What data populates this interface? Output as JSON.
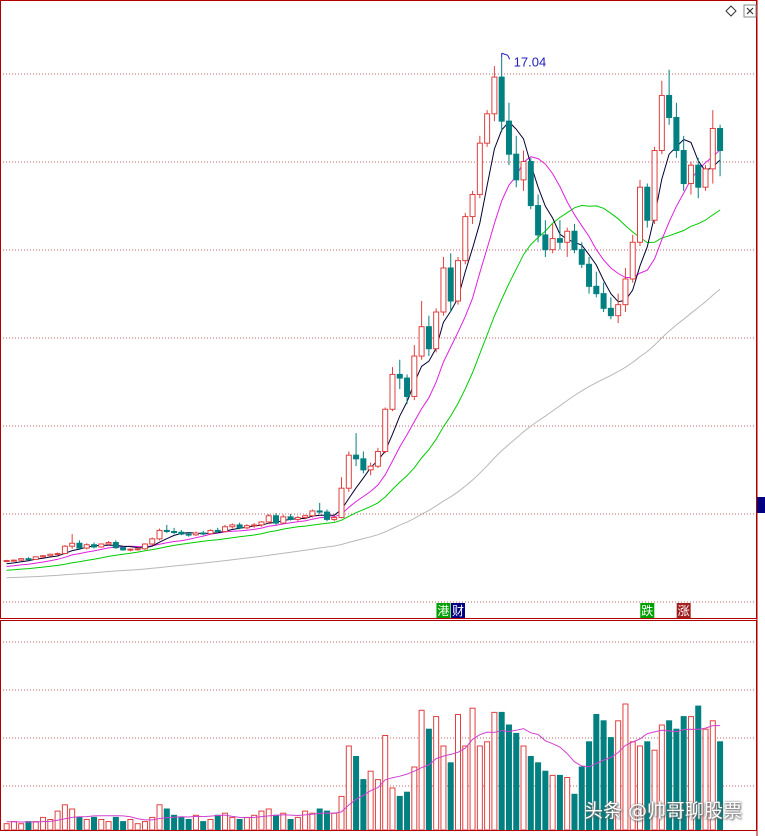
{
  "colors": {
    "border": "#b00000",
    "up": "#e04040",
    "down": "#008080",
    "ma5": "#000033",
    "ma10": "#e020e0",
    "ma20": "#00cc00",
    "ma60": "#b8b8b8",
    "vol_ma": "#d040d0",
    "peak_label": "#2020c0",
    "grid": "#c06060"
  },
  "chart_data": {
    "type": "candlestick",
    "peak": {
      "index": 68,
      "value": 17.04,
      "label": "17.04"
    },
    "price_ylim": [
      2.2,
      18.6
    ],
    "volume_ylim": [
      0,
      100
    ],
    "markers": [
      {
        "index": 60,
        "text": "港",
        "color": "#00a000"
      },
      {
        "index": 62,
        "text": "财",
        "color": "#000080"
      },
      {
        "index": 88,
        "text": "跌",
        "color": "#00a000"
      },
      {
        "index": 93,
        "text": "涨",
        "color": "#a02020"
      }
    ],
    "ohlc": [
      [
        3.31,
        3.35,
        3.28,
        3.33
      ],
      [
        3.33,
        3.36,
        3.3,
        3.34
      ],
      [
        3.34,
        3.4,
        3.32,
        3.38
      ],
      [
        3.38,
        3.42,
        3.34,
        3.36
      ],
      [
        3.36,
        3.45,
        3.35,
        3.43
      ],
      [
        3.43,
        3.48,
        3.4,
        3.46
      ],
      [
        3.46,
        3.52,
        3.44,
        3.5
      ],
      [
        3.5,
        3.55,
        3.47,
        3.52
      ],
      [
        3.52,
        3.75,
        3.5,
        3.72
      ],
      [
        3.72,
        4.05,
        3.65,
        3.8
      ],
      [
        3.8,
        3.88,
        3.62,
        3.67
      ],
      [
        3.67,
        3.8,
        3.63,
        3.76
      ],
      [
        3.76,
        3.82,
        3.66,
        3.7
      ],
      [
        3.7,
        3.8,
        3.68,
        3.78
      ],
      [
        3.78,
        3.86,
        3.74,
        3.82
      ],
      [
        3.82,
        3.88,
        3.65,
        3.68
      ],
      [
        3.68,
        3.72,
        3.6,
        3.62
      ],
      [
        3.62,
        3.66,
        3.58,
        3.64
      ],
      [
        3.64,
        3.68,
        3.6,
        3.65
      ],
      [
        3.65,
        3.8,
        3.62,
        3.78
      ],
      [
        3.78,
        3.96,
        3.74,
        3.92
      ],
      [
        3.92,
        4.2,
        3.88,
        4.15
      ],
      [
        4.15,
        4.3,
        4.08,
        4.12
      ],
      [
        4.12,
        4.22,
        4.05,
        4.1
      ],
      [
        4.1,
        4.16,
        4.02,
        4.05
      ],
      [
        4.05,
        4.1,
        3.98,
        4.03
      ],
      [
        4.03,
        4.12,
        4.0,
        4.08
      ],
      [
        4.08,
        4.14,
        4.02,
        4.06
      ],
      [
        4.06,
        4.18,
        4.04,
        4.15
      ],
      [
        4.15,
        4.22,
        4.08,
        4.12
      ],
      [
        4.12,
        4.3,
        4.1,
        4.25
      ],
      [
        4.25,
        4.34,
        4.2,
        4.3
      ],
      [
        4.3,
        4.36,
        4.18,
        4.22
      ],
      [
        4.22,
        4.32,
        4.18,
        4.28
      ],
      [
        4.28,
        4.35,
        4.22,
        4.3
      ],
      [
        4.3,
        4.4,
        4.25,
        4.38
      ],
      [
        4.38,
        4.6,
        4.32,
        4.55
      ],
      [
        4.55,
        4.62,
        4.3,
        4.35
      ],
      [
        4.35,
        4.58,
        4.32,
        4.52
      ],
      [
        4.52,
        4.6,
        4.42,
        4.45
      ],
      [
        4.45,
        4.55,
        4.4,
        4.5
      ],
      [
        4.5,
        4.58,
        4.45,
        4.55
      ],
      [
        4.55,
        4.72,
        4.5,
        4.68
      ],
      [
        4.68,
        4.9,
        4.6,
        4.65
      ],
      [
        4.65,
        4.72,
        4.4,
        4.45
      ],
      [
        4.45,
        4.56,
        4.4,
        4.5
      ],
      [
        4.5,
        5.6,
        4.48,
        5.3
      ],
      [
        5.3,
        6.3,
        5.2,
        6.2
      ],
      [
        6.2,
        6.8,
        5.9,
        6.1
      ],
      [
        6.1,
        6.3,
        5.7,
        5.8
      ],
      [
        5.8,
        6.0,
        5.65,
        5.9
      ],
      [
        5.9,
        6.4,
        5.85,
        6.3
      ],
      [
        6.3,
        7.5,
        6.25,
        7.45
      ],
      [
        7.45,
        8.6,
        7.4,
        8.4
      ],
      [
        8.4,
        8.8,
        8.0,
        8.3
      ],
      [
        8.3,
        8.4,
        7.6,
        7.8
      ],
      [
        7.8,
        9.2,
        7.7,
        8.9
      ],
      [
        8.9,
        10.4,
        8.8,
        9.7
      ],
      [
        9.7,
        10.0,
        8.9,
        9.1
      ],
      [
        9.1,
        10.2,
        9.0,
        10.1
      ],
      [
        10.1,
        11.6,
        10.0,
        11.3
      ],
      [
        11.3,
        11.7,
        10.1,
        10.4
      ],
      [
        10.4,
        11.6,
        10.3,
        11.5
      ],
      [
        11.5,
        12.8,
        11.4,
        12.7
      ],
      [
        12.7,
        13.4,
        12.5,
        13.3
      ],
      [
        13.3,
        14.9,
        13.2,
        14.7
      ],
      [
        14.7,
        15.6,
        14.6,
        15.5
      ],
      [
        15.5,
        16.8,
        15.3,
        16.5
      ],
      [
        16.5,
        17.04,
        15.0,
        15.3
      ],
      [
        15.3,
        15.8,
        14.1,
        14.4
      ],
      [
        14.4,
        14.9,
        13.5,
        13.7
      ],
      [
        13.7,
        14.5,
        13.4,
        14.2
      ],
      [
        14.2,
        14.3,
        12.9,
        13.0
      ],
      [
        13.0,
        13.3,
        12.0,
        12.2
      ],
      [
        12.2,
        12.6,
        11.6,
        11.8
      ],
      [
        11.8,
        12.5,
        11.7,
        12.1
      ],
      [
        12.1,
        12.6,
        11.8,
        12.0
      ],
      [
        12.0,
        12.4,
        11.6,
        12.3
      ],
      [
        12.3,
        12.5,
        11.7,
        11.8
      ],
      [
        11.8,
        12.0,
        11.3,
        11.4
      ],
      [
        11.4,
        11.6,
        10.6,
        10.8
      ],
      [
        10.8,
        11.2,
        10.5,
        10.6
      ],
      [
        10.6,
        10.9,
        10.1,
        10.2
      ],
      [
        10.2,
        10.5,
        9.9,
        10.0
      ],
      [
        10.0,
        10.6,
        9.8,
        10.3
      ],
      [
        10.3,
        11.3,
        10.1,
        11.0
      ],
      [
        11.0,
        12.2,
        10.9,
        12.0
      ],
      [
        12.0,
        13.7,
        11.9,
        13.5
      ],
      [
        13.5,
        13.6,
        12.4,
        12.6
      ],
      [
        12.6,
        14.6,
        12.5,
        14.5
      ],
      [
        14.5,
        16.4,
        14.4,
        16.0
      ],
      [
        16.0,
        16.7,
        15.2,
        15.4
      ],
      [
        15.4,
        15.8,
        14.3,
        14.5
      ],
      [
        14.5,
        14.9,
        13.4,
        13.6
      ],
      [
        13.6,
        14.2,
        13.3,
        14.1
      ],
      [
        14.1,
        14.3,
        13.2,
        13.5
      ],
      [
        13.5,
        14.1,
        13.4,
        14.0
      ],
      [
        14.0,
        15.6,
        13.6,
        15.1
      ],
      [
        15.1,
        15.2,
        13.8,
        14.5
      ]
    ],
    "volume": [
      3,
      4,
      3,
      4,
      4,
      6,
      5,
      9,
      12,
      10,
      6,
      5,
      6,
      5,
      4,
      6,
      4,
      5,
      3,
      4,
      6,
      12,
      10,
      7,
      6,
      5,
      7,
      4,
      5,
      7,
      8,
      6,
      5,
      6,
      7,
      9,
      10,
      7,
      8,
      5,
      6,
      9,
      8,
      10,
      9,
      8,
      16,
      40,
      35,
      24,
      28,
      24,
      45,
      20,
      16,
      18,
      30,
      57,
      48,
      54,
      40,
      32,
      55,
      40,
      58,
      40,
      42,
      56,
      56,
      50,
      46,
      40,
      35,
      32,
      28,
      26,
      26,
      25,
      17,
      30,
      42,
      55,
      52,
      44,
      52,
      60,
      42,
      40,
      42,
      38,
      50,
      52,
      48,
      54,
      54,
      59,
      48,
      52,
      42
    ]
  }
}
